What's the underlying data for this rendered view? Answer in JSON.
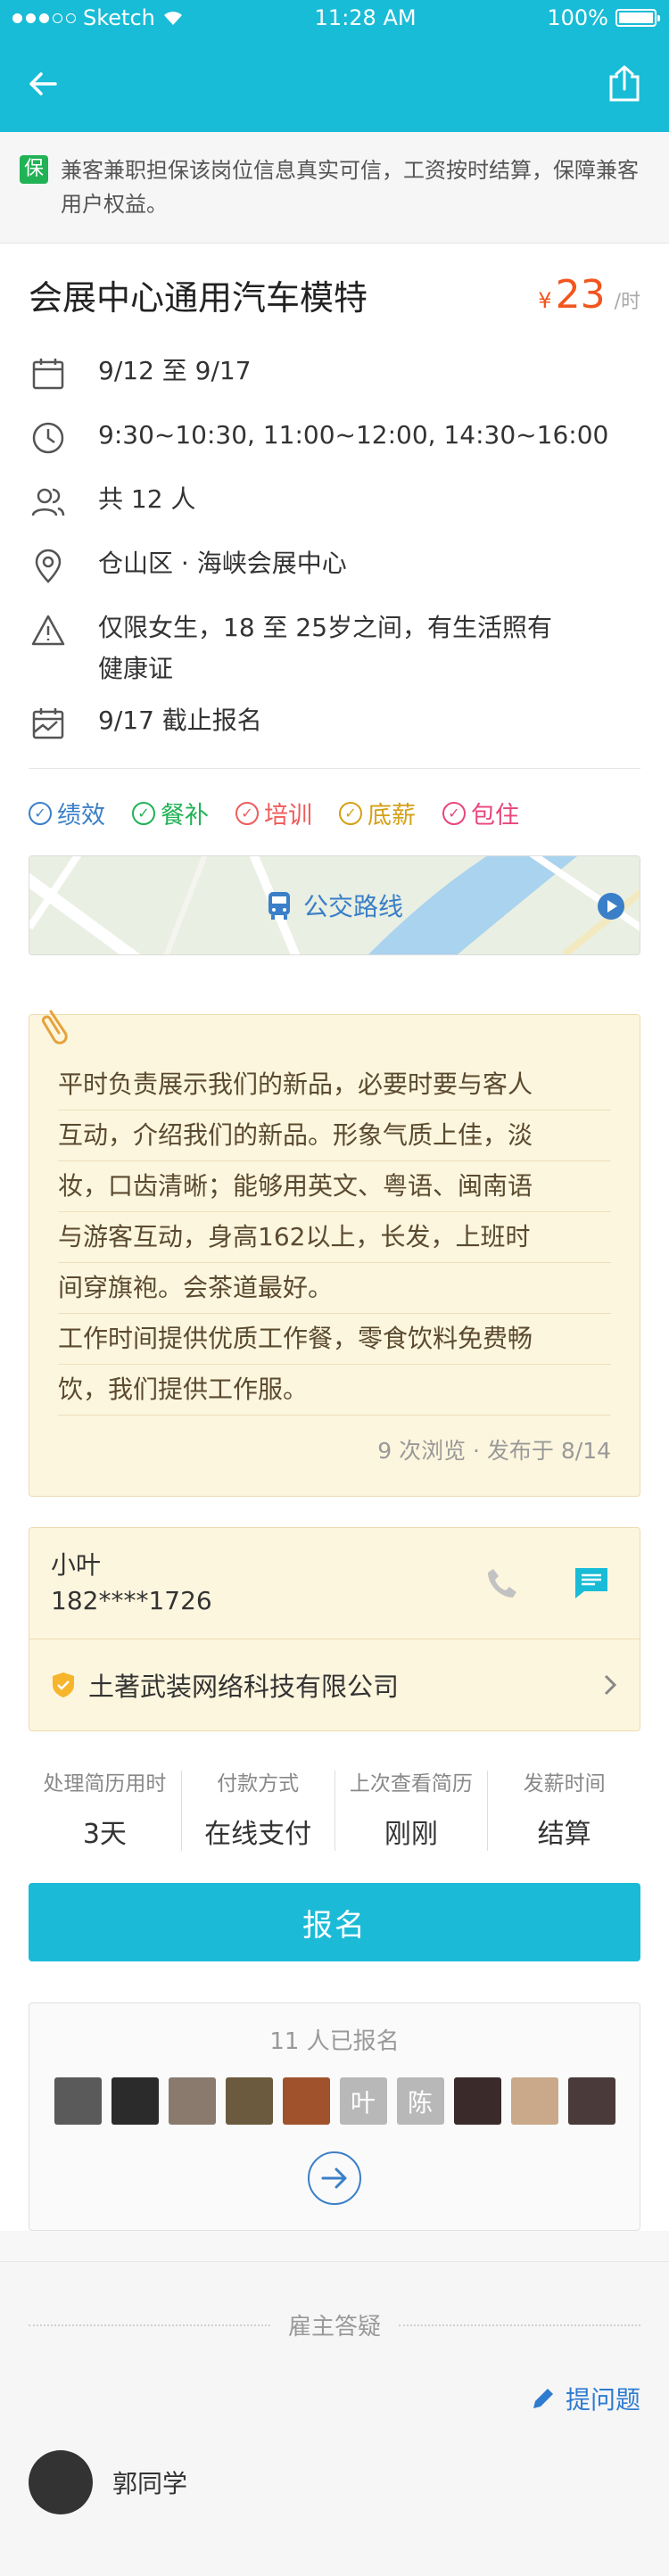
{
  "status_bar": {
    "carrier": "Sketch",
    "time": "11:28 AM",
    "battery": "100%"
  },
  "navbar": {
    "back_icon": "back-arrow-icon",
    "share_icon": "share-icon"
  },
  "notice": {
    "badge": "保",
    "text": "兼客兼职担保该岗位信息真实可信，工资按时结算，保障兼客用户权益。"
  },
  "job": {
    "title": "会展中心通用汽车模特",
    "price_symbol": "¥",
    "price": "23",
    "price_unit": "/时",
    "date_range": "9/12 至 9/17",
    "time_slots": "9:30~10:30, 11:00~12:00, 14:30~16:00",
    "headcount": "共 12 人",
    "location": "仓山区 · 海峡会展中心",
    "requirements": "仅限女生，18 至 25岁之间，有生活照有健康证",
    "deadline": "9/17 截止报名"
  },
  "tags": [
    {
      "label": "绩效",
      "color": "#3a7fc8"
    },
    {
      "label": "餐补",
      "color": "#21b256"
    },
    {
      "label": "培训",
      "color": "#ef5b5b"
    },
    {
      "label": "底薪",
      "color": "#d4a017"
    },
    {
      "label": "包住",
      "color": "#e8457a"
    }
  ],
  "map": {
    "label": "公交路线"
  },
  "description": {
    "lines": [
      "平时负责展示我们的新品，必要时要与客人",
      "互动，介绍我们的新品。形象气质上佳，淡",
      "妆，口齿清晰；能够用英文、粤语、闽南语",
      "与游客互动，身高162以上，长发，上班时",
      "间穿旗袍。会茶道最好。",
      "工作时间提供优质工作餐，零食饮料免费畅",
      "饮，我们提供工作服。"
    ],
    "meta": "9 次浏览 · 发布于 8/14"
  },
  "contact": {
    "name": "小叶",
    "phone": "182****1726",
    "company": "土著武装网络科技有限公司"
  },
  "stats": [
    {
      "label": "处理简历用时",
      "value": "3天"
    },
    {
      "label": "付款方式",
      "value": "在线支付"
    },
    {
      "label": "上次查看简历",
      "value": "刚刚"
    },
    {
      "label": "发薪时间",
      "value": "结算"
    }
  ],
  "signup_label": "报名",
  "applicants": {
    "count_text": "11 人已报名",
    "avatars": [
      {
        "text": "",
        "color": "#5a5a5a"
      },
      {
        "text": "",
        "color": "#2b2b2b"
      },
      {
        "text": "",
        "color": "#8a7a6e"
      },
      {
        "text": "",
        "color": "#6b5a3e"
      },
      {
        "text": "",
        "color": "#a0522d"
      },
      {
        "text": "叶",
        "color": "#b8b8b8"
      },
      {
        "text": "陈",
        "color": "#b8b8b8"
      },
      {
        "text": "",
        "color": "#3a2a2a"
      },
      {
        "text": "",
        "color": "#c9a98a"
      },
      {
        "text": "",
        "color": "#4a3a3a"
      }
    ]
  },
  "qa": {
    "heading": "雇主答疑",
    "ask_label": "提问题",
    "first_user": "郭同学"
  }
}
